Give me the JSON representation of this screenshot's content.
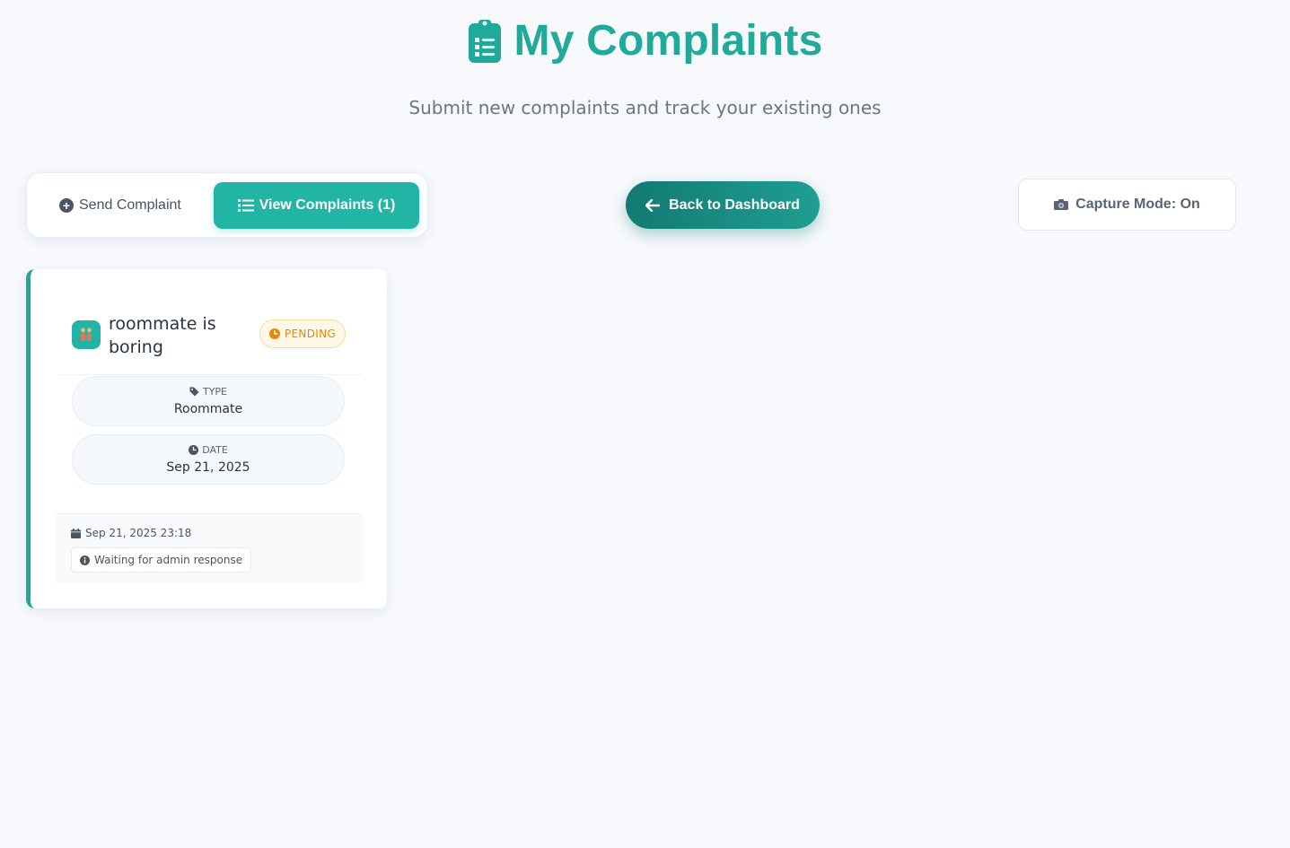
{
  "header": {
    "icon": "clipboard-list-icon",
    "title": "My Complaints",
    "subtitle": "Submit new complaints and track your existing ones",
    "accent_color": "#1faa9a"
  },
  "tabs": {
    "send": {
      "icon": "plus-circle-icon",
      "label": "Send Complaint"
    },
    "view": {
      "icon": "list-icon",
      "label": "View Complaints (1)",
      "active": true
    }
  },
  "back_button": {
    "icon": "arrow-left-icon",
    "label": "Back to Dashboard"
  },
  "capture": {
    "icon": "camera-icon",
    "label": "Capture Mode: On"
  },
  "complaints": [
    {
      "category_icon": "roommate-icon",
      "title": "roommate is boring",
      "status": {
        "icon": "clock-icon",
        "label": "PENDING",
        "color": "#e08a0a"
      },
      "type": {
        "icon": "tag-icon",
        "label": "TYPE",
        "value": "Roommate"
      },
      "date": {
        "icon": "clock-icon",
        "label": "DATE",
        "value": "Sep 21, 2025"
      },
      "submitted": {
        "icon": "calendar-icon",
        "value": "Sep 21, 2025 23:18"
      },
      "response": {
        "icon": "info-icon",
        "value": "Waiting for admin response"
      }
    }
  ]
}
